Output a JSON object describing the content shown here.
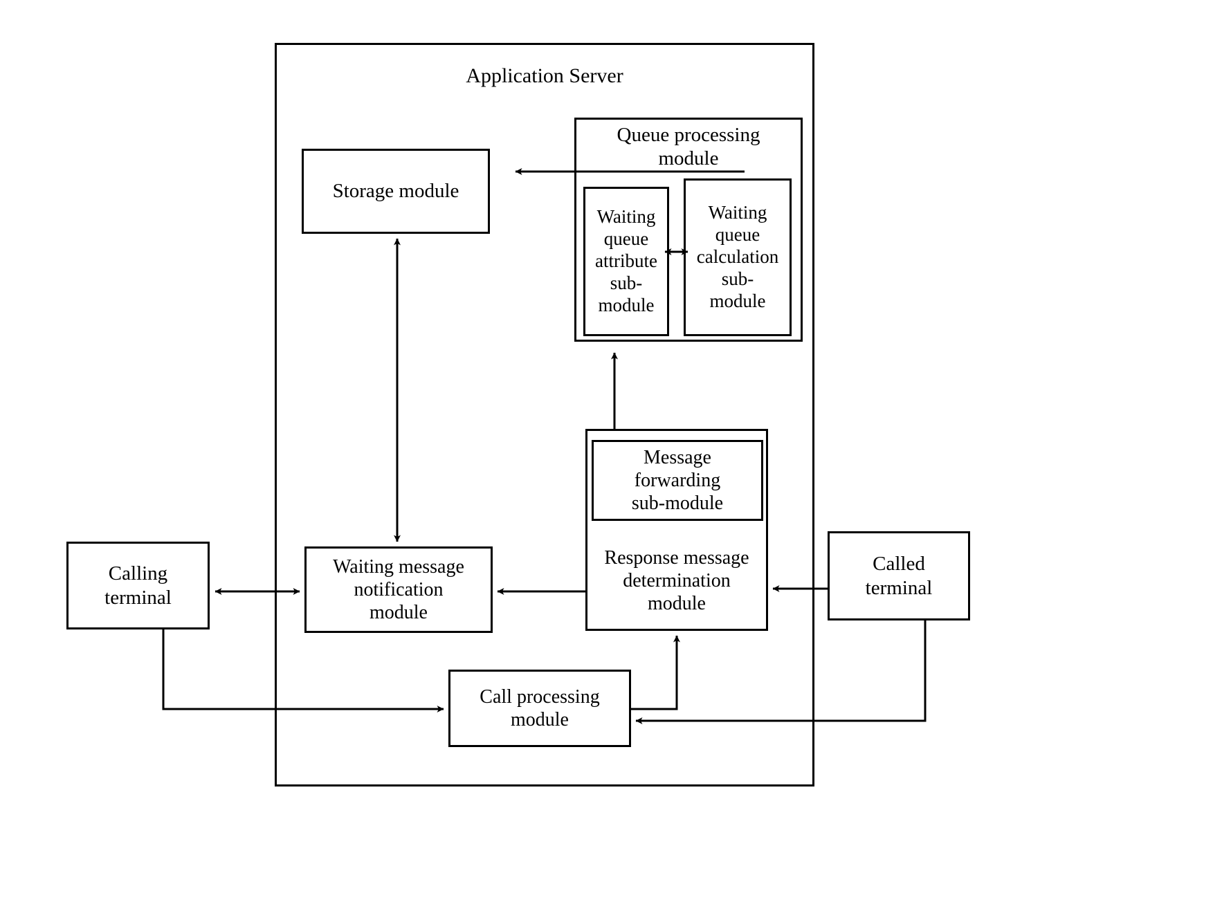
{
  "diagram": {
    "title": "Application Server",
    "type": "block-diagram",
    "outer_frame_label": "Application Server",
    "blocks": {
      "storage_module": "Storage module",
      "queue_processing_module": "Queue processing\nmodule",
      "waiting_queue_attribute_sub_module": "Waiting\nqueue\nattribute\nsub-\nmodule",
      "waiting_queue_calculation_sub_module": "Waiting\nqueue\ncalculation\nsub-\nmodule",
      "message_forwarding_sub_module": "Message\nforwarding\nsub-module",
      "response_message_determination_module": "Response message\ndetermination\nmodule",
      "waiting_message_notification_module": "Waiting message\nnotification\nmodule",
      "call_processing_module": "Call processing\nmodule",
      "calling_terminal": "Calling\nterminal",
      "called_terminal": "Called\nterminal"
    },
    "connections": [
      {
        "from": "queue_processing_module",
        "to": "storage_module",
        "direction": "one-way"
      },
      {
        "from": "waiting_queue_attribute_sub_module",
        "to": "waiting_queue_calculation_sub_module",
        "direction": "two-way"
      },
      {
        "from": "response_message_determination_module",
        "to": "queue_processing_module",
        "direction": "one-way"
      },
      {
        "from": "storage_module",
        "to": "waiting_message_notification_module",
        "direction": "two-way"
      },
      {
        "from": "calling_terminal",
        "to": "waiting_message_notification_module",
        "direction": "two-way"
      },
      {
        "from": "response_message_determination_module",
        "to": "waiting_message_notification_module",
        "direction": "one-way"
      },
      {
        "from": "called_terminal",
        "to": "response_message_determination_module",
        "direction": "one-way"
      },
      {
        "from": "calling_terminal",
        "to": "call_processing_module",
        "direction": "one-way"
      },
      {
        "from": "call_processing_module",
        "to": "response_message_determination_module",
        "direction": "one-way"
      },
      {
        "from": "called_terminal",
        "to": "call_processing_module",
        "direction": "one-way"
      }
    ],
    "colors": {
      "line": "#000000",
      "background": "#ffffff",
      "text": "#000000"
    }
  }
}
